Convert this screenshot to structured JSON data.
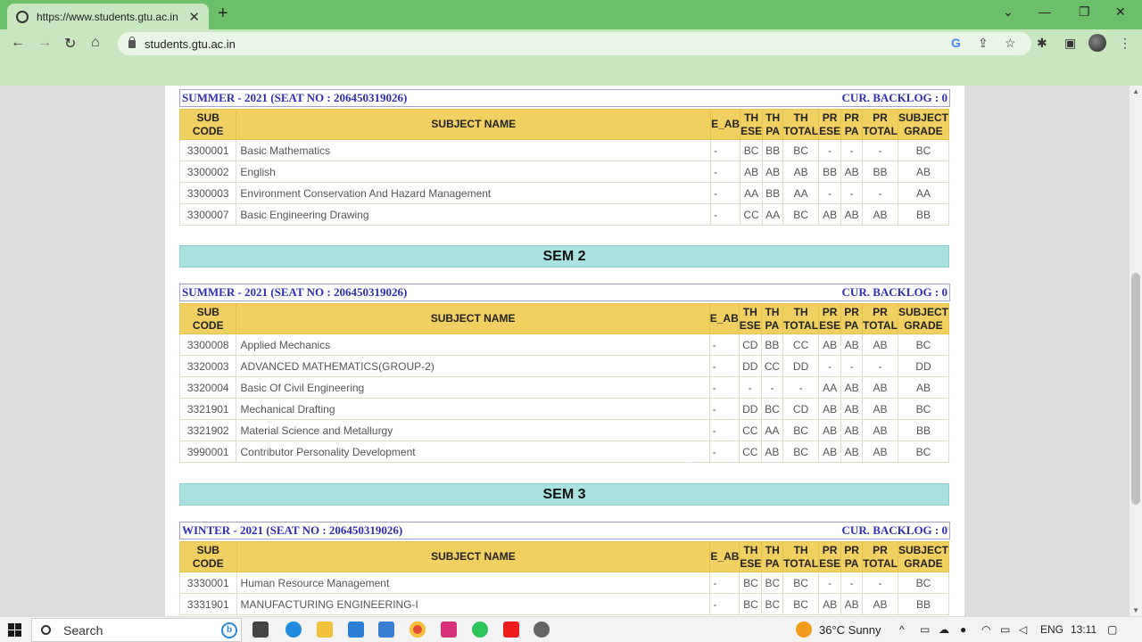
{
  "browser": {
    "tab_title": "https://www.students.gtu.ac.in",
    "tab_close": "✕",
    "new_tab": "+",
    "url": "students.gtu.ac.in"
  },
  "sections": [
    {
      "session": "SUMMER - 2021 (SEAT NO : 206450319026)",
      "backlog": "CUR. BACKLOG : 0",
      "rows": [
        [
          "3300001",
          "Basic Mathematics",
          "-",
          "BC",
          "BB",
          "BC",
          "-",
          "-",
          "-",
          "BC"
        ],
        [
          "3300002",
          "English",
          "-",
          "AB",
          "AB",
          "AB",
          "BB",
          "AB",
          "BB",
          "AB"
        ],
        [
          "3300003",
          "Environment Conservation And Hazard Management",
          "-",
          "AA",
          "BB",
          "AA",
          "-",
          "-",
          "-",
          "AA"
        ],
        [
          "3300007",
          "Basic Engineering Drawing",
          "-",
          "CC",
          "AA",
          "BC",
          "AB",
          "AB",
          "AB",
          "BB"
        ]
      ]
    },
    {
      "sem_label": "SEM 2",
      "session": "SUMMER - 2021 (SEAT NO : 206450319026)",
      "backlog": "CUR. BACKLOG : 0",
      "rows": [
        [
          "3300008",
          "Applied Mechanics",
          "-",
          "CD",
          "BB",
          "CC",
          "AB",
          "AB",
          "AB",
          "BC"
        ],
        [
          "3320003",
          "ADVANCED MATHEMATICS(GROUP-2)",
          "-",
          "DD",
          "CC",
          "DD",
          "-",
          "-",
          "-",
          "DD"
        ],
        [
          "3320004",
          "Basic Of Civil Engineering",
          "-",
          "-",
          "-",
          "-",
          "AA",
          "AB",
          "AB",
          "AB"
        ],
        [
          "3321901",
          "Mechanical Drafting",
          "-",
          "DD",
          "BC",
          "CD",
          "AB",
          "AB",
          "AB",
          "BC"
        ],
        [
          "3321902",
          "Material Science and Metallurgy",
          "-",
          "CC",
          "AA",
          "BC",
          "AB",
          "AB",
          "AB",
          "BB"
        ],
        [
          "3990001",
          "Contributor Personality Development",
          "-",
          "CC",
          "AB",
          "BC",
          "AB",
          "AB",
          "AB",
          "BC"
        ]
      ]
    },
    {
      "sem_label": "SEM 3",
      "session": "WINTER - 2021 (SEAT NO : 206450319026)",
      "backlog": "CUR. BACKLOG : 0",
      "rows": [
        [
          "3330001",
          "Human Resource Management",
          "-",
          "BC",
          "BC",
          "BC",
          "-",
          "-",
          "-",
          "BC"
        ],
        [
          "3331901",
          "MANUFACTURING ENGINEERING-I",
          "-",
          "BC",
          "BC",
          "BC",
          "AB",
          "AB",
          "AB",
          "BB"
        ]
      ]
    }
  ],
  "table_headers": {
    "sub_code": "SUB CODE",
    "subject_name": "SUBJECT NAME",
    "e_ab": "E_AB",
    "th_ese_1": "TH",
    "th_ese_2": "ESE",
    "th_pa_1": "TH",
    "th_pa_2": "PA",
    "th_total_1": "TH",
    "th_total_2": "TOTAL",
    "pr_ese_1": "PR",
    "pr_ese_2": "ESE",
    "pr_pa_1": "PR",
    "pr_pa_2": "PA",
    "pr_total_1": "PR",
    "pr_total_2": "TOTAL",
    "grade_1": "SUBJECT",
    "grade_2": "GRADE"
  },
  "taskbar": {
    "search_placeholder": "Search",
    "weather": "36°C  Sunny",
    "language": "ENG",
    "time": "13:11"
  },
  "colors": {
    "tab_bar": "#6cc06a",
    "toolbar": "#c8e6c0",
    "header_row": "#f0d060",
    "sem_bar": "#a9e1e1",
    "session_text": "#2f2fb5"
  }
}
